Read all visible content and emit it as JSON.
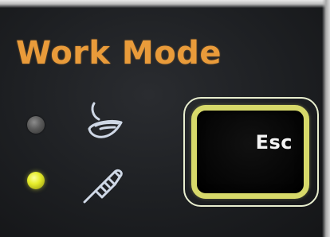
{
  "panel": {
    "title": "Work Mode",
    "title_color": "#e99b3a"
  },
  "modes": [
    {
      "icon": "bowl-icon",
      "indicator": "off"
    },
    {
      "icon": "stick-wand-icon",
      "indicator": "on",
      "indicator_color": "#e5ec2a"
    }
  ],
  "esc_key": {
    "label": "Esc",
    "border_color": "#d7d96a"
  }
}
